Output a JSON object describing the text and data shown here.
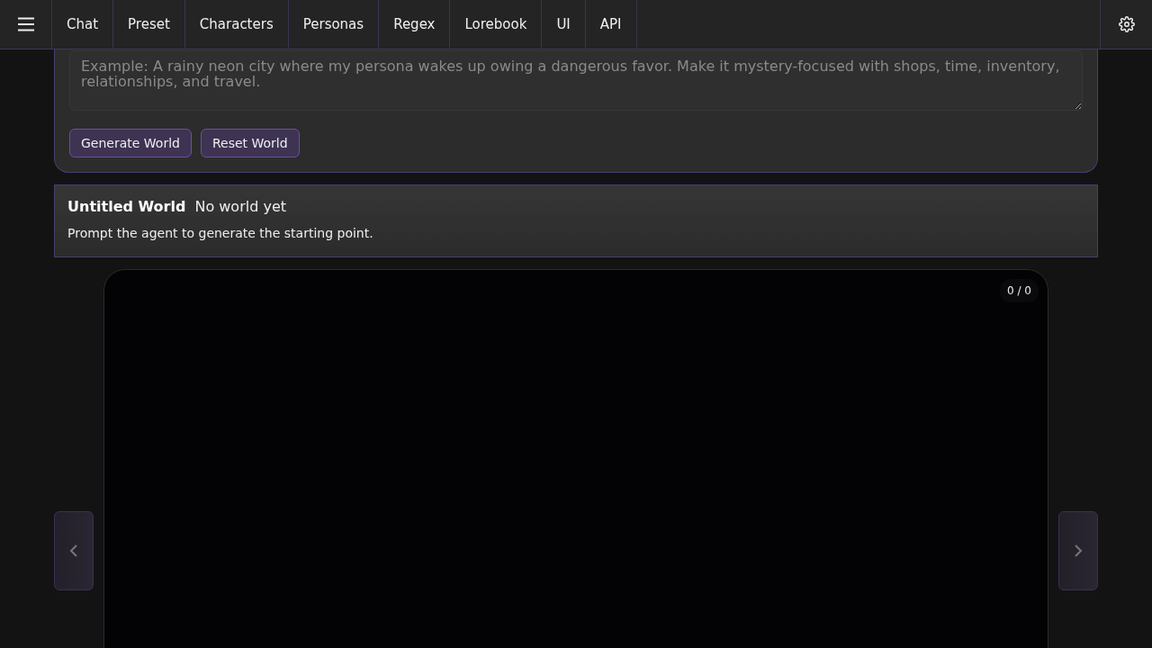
{
  "nav": {
    "tabs": [
      {
        "label": "Chat",
        "selected": false
      },
      {
        "label": "Preset",
        "selected": false
      },
      {
        "label": "Characters",
        "selected": false
      },
      {
        "label": "Personas",
        "selected": false
      },
      {
        "label": "Regex",
        "selected": false
      },
      {
        "label": "Lorebook",
        "selected": false
      },
      {
        "label": "UI",
        "selected": false
      },
      {
        "label": "API",
        "selected": false
      }
    ]
  },
  "world_prompt": {
    "placeholder": "Example: A rainy neon city where my persona wakes up owing a dangerous favor. Make it mystery-focused with shops, time, inventory, relationships, and travel.",
    "buttons": [
      "Generate World",
      "Reset World"
    ]
  },
  "world": {
    "title": "Untitled World",
    "status": "No world yet",
    "description": "Prompt the agent to generate the starting point."
  },
  "viewer": {
    "counter": "0 / 0"
  }
}
